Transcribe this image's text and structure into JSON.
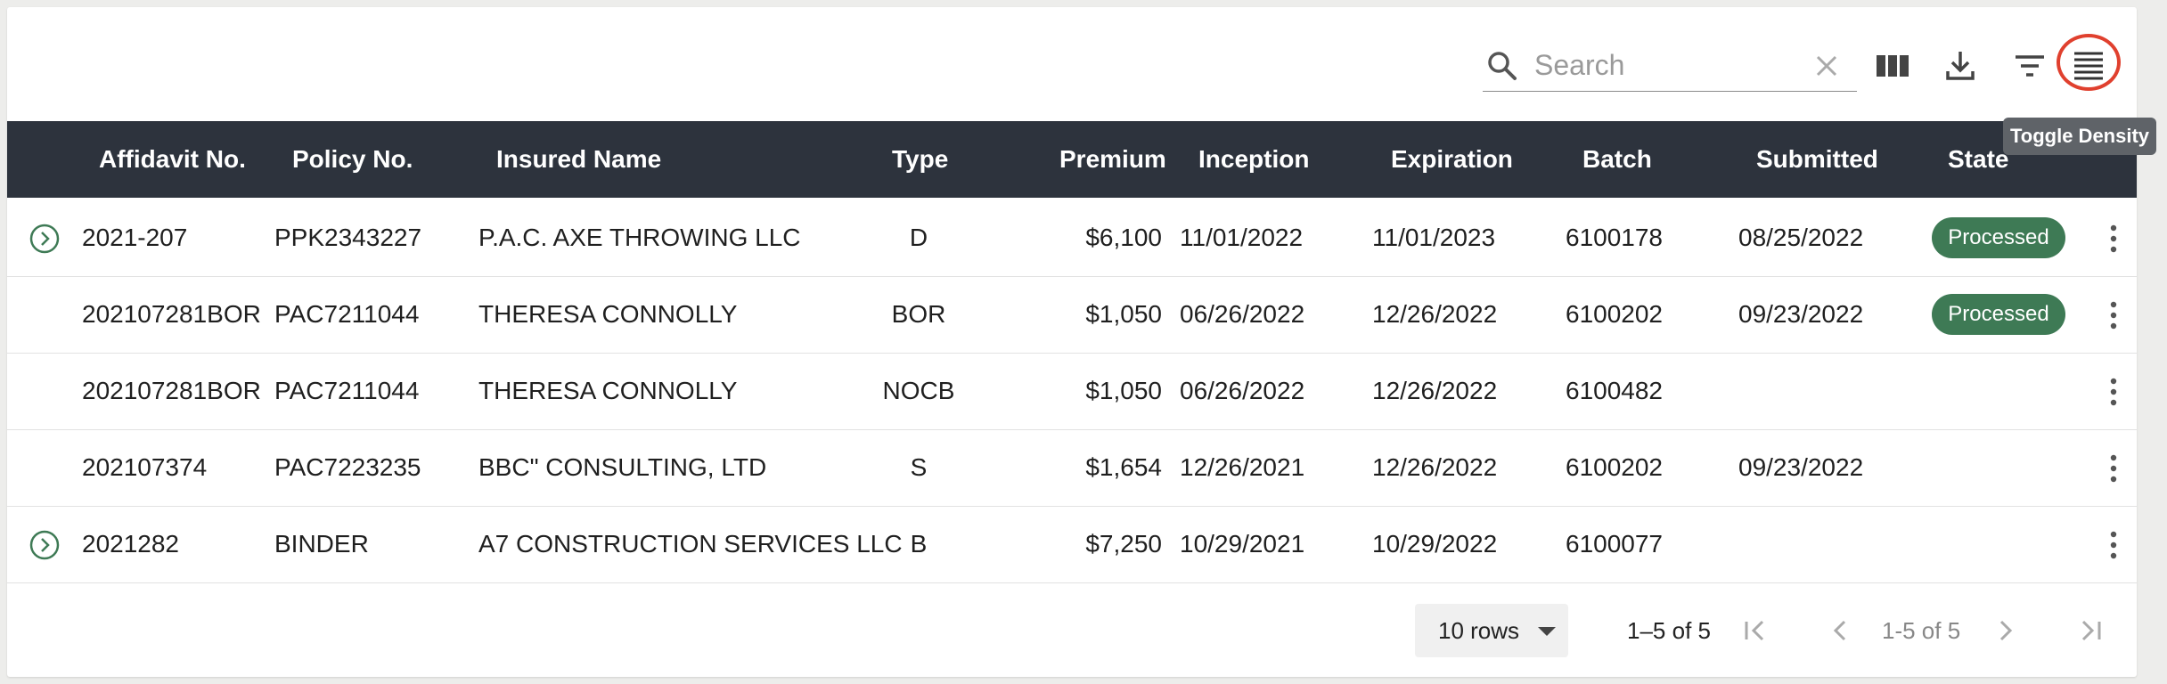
{
  "toolbar": {
    "search_placeholder": "Search",
    "search_value": "",
    "icons": [
      "search-icon",
      "clear-icon",
      "columns-icon",
      "download-icon",
      "filter-icon",
      "density-icon"
    ],
    "tooltip": "Toggle Density",
    "highlight_color": "#e0402e"
  },
  "table": {
    "header_bg": "#2d333d",
    "columns": [
      "Affidavit No.",
      "Policy No.",
      "Insured Name",
      "Type",
      "Premium",
      "Inception",
      "Expiration",
      "Batch",
      "Submitted",
      "State"
    ],
    "rows": [
      {
        "expandable": true,
        "affidavit": "2021-207",
        "policy": "PPK2343227",
        "insured": "P.A.C. AXE THROWING LLC",
        "type": "D",
        "premium": "$6,100",
        "inception": "11/01/2022",
        "expiration": "11/01/2023",
        "batch": "6100178",
        "submitted": "08/25/2022",
        "state": "Processed"
      },
      {
        "expandable": false,
        "affidavit": "202107281BOR",
        "policy": "PAC7211044",
        "insured": "THERESA CONNOLLY",
        "type": "BOR",
        "premium": "$1,050",
        "inception": "06/26/2022",
        "expiration": "12/26/2022",
        "batch": "6100202",
        "submitted": "09/23/2022",
        "state": "Processed"
      },
      {
        "expandable": false,
        "affidavit": "202107281BOR",
        "policy": "PAC7211044",
        "insured": "THERESA CONNOLLY",
        "type": "NOCB",
        "premium": "$1,050",
        "inception": "06/26/2022",
        "expiration": "12/26/2022",
        "batch": "6100482",
        "submitted": "",
        "state": ""
      },
      {
        "expandable": false,
        "affidavit": "202107374",
        "policy": "PAC7223235",
        "insured": "BBC\" CONSULTING, LTD",
        "type": "S",
        "premium": "$1,654",
        "inception": "12/26/2021",
        "expiration": "12/26/2022",
        "batch": "6100202",
        "submitted": "09/23/2022",
        "state": ""
      },
      {
        "expandable": true,
        "affidavit": "2021282",
        "policy": "BINDER",
        "insured": "A7 CONSTRUCTION SERVICES LLC",
        "type": "B",
        "premium": "$7,250",
        "inception": "10/29/2021",
        "expiration": "10/29/2022",
        "batch": "6100077",
        "submitted": "",
        "state": ""
      }
    ],
    "status_color": "#3e7a55"
  },
  "pagination": {
    "rows_per_page": "10 rows",
    "range": "1–5 of 5",
    "page_label": "1-5 of 5"
  }
}
